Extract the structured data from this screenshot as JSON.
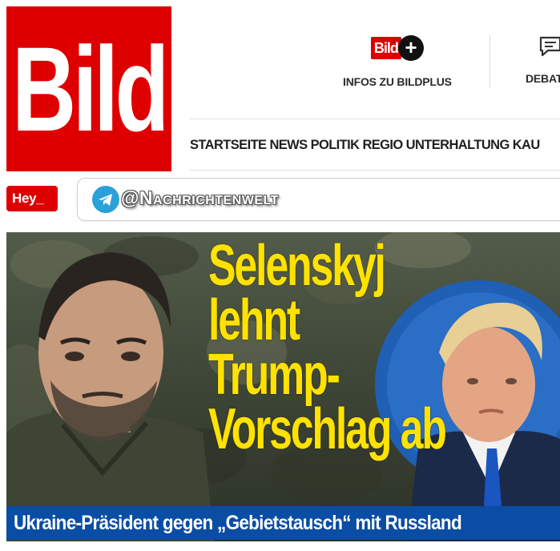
{
  "logo": {
    "text": "Bild",
    "color": "#de0000"
  },
  "header": {
    "bildplus": {
      "badge_text": "Bild",
      "plus_symbol": "+",
      "label": "INFOS ZU BILDPLUS"
    },
    "debatte": {
      "label": "DEBAT",
      "icon": "chat-bubble-icon"
    }
  },
  "nav": {
    "items": [
      "STARTSEITE",
      "NEWS",
      "POLITIK",
      "REGIO",
      "UNTERHALTUNG",
      "KAU"
    ]
  },
  "hey": {
    "label": "Hey_"
  },
  "overlay": {
    "icon": "telegram-icon",
    "handle": "@Nachrichtenwelt"
  },
  "hero": {
    "headline_lines": [
      "Selenskyj",
      "lehnt",
      "Trump-",
      "Vorschlag ab"
    ],
    "caption": "Ukraine-Präsident gegen „Gebietstausch“ mit Russland",
    "colors": {
      "headline": "#ffe200",
      "caption_bg": "#0a4da4"
    }
  }
}
